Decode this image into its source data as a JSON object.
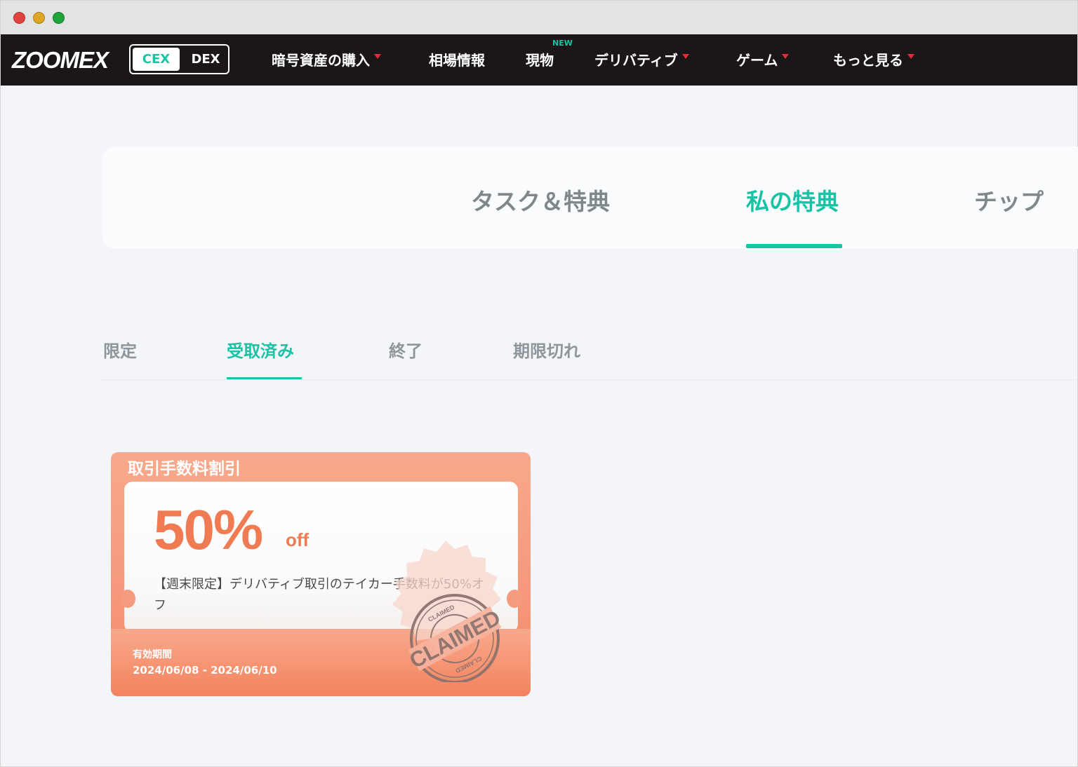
{
  "nav": {
    "logo": "ZOOMEX",
    "switch": {
      "cex": "CEX",
      "dex": "DEX"
    },
    "items": [
      {
        "label": "暗号資産の購入",
        "dropdown": true
      },
      {
        "label": "相場情報",
        "dropdown": false
      },
      {
        "label": "現物",
        "dropdown": false,
        "badge": "NEW"
      },
      {
        "label": "デリバティブ",
        "dropdown": true
      },
      {
        "label": "ゲーム",
        "dropdown": true
      },
      {
        "label": "もっと見る",
        "dropdown": true
      }
    ]
  },
  "main_tabs": [
    {
      "label": "タスク＆特典",
      "active": false
    },
    {
      "label": "私の特典",
      "active": true
    },
    {
      "label": "チップ",
      "active": false
    }
  ],
  "sub_tabs": [
    {
      "label": "限定",
      "active": false
    },
    {
      "label": "受取済み",
      "active": true
    },
    {
      "label": "終了",
      "active": false
    },
    {
      "label": "期限切れ",
      "active": false
    }
  ],
  "coupon": {
    "title": "取引手数料割引",
    "percent": "50%",
    "off": "off",
    "description": "【週末限定】デリバティブ取引のテイカー手数料が50%オフ",
    "valid_label": "有効期間",
    "valid_range": "2024/06/08 - 2024/06/10",
    "stamp_text": "CLAIMED",
    "stamp_ring_text": "CLAIMED"
  },
  "colors": {
    "accent": "#19c3a5",
    "nav_bg": "#1b1718",
    "coupon": "#f6977a",
    "caret": "#e32c39"
  }
}
